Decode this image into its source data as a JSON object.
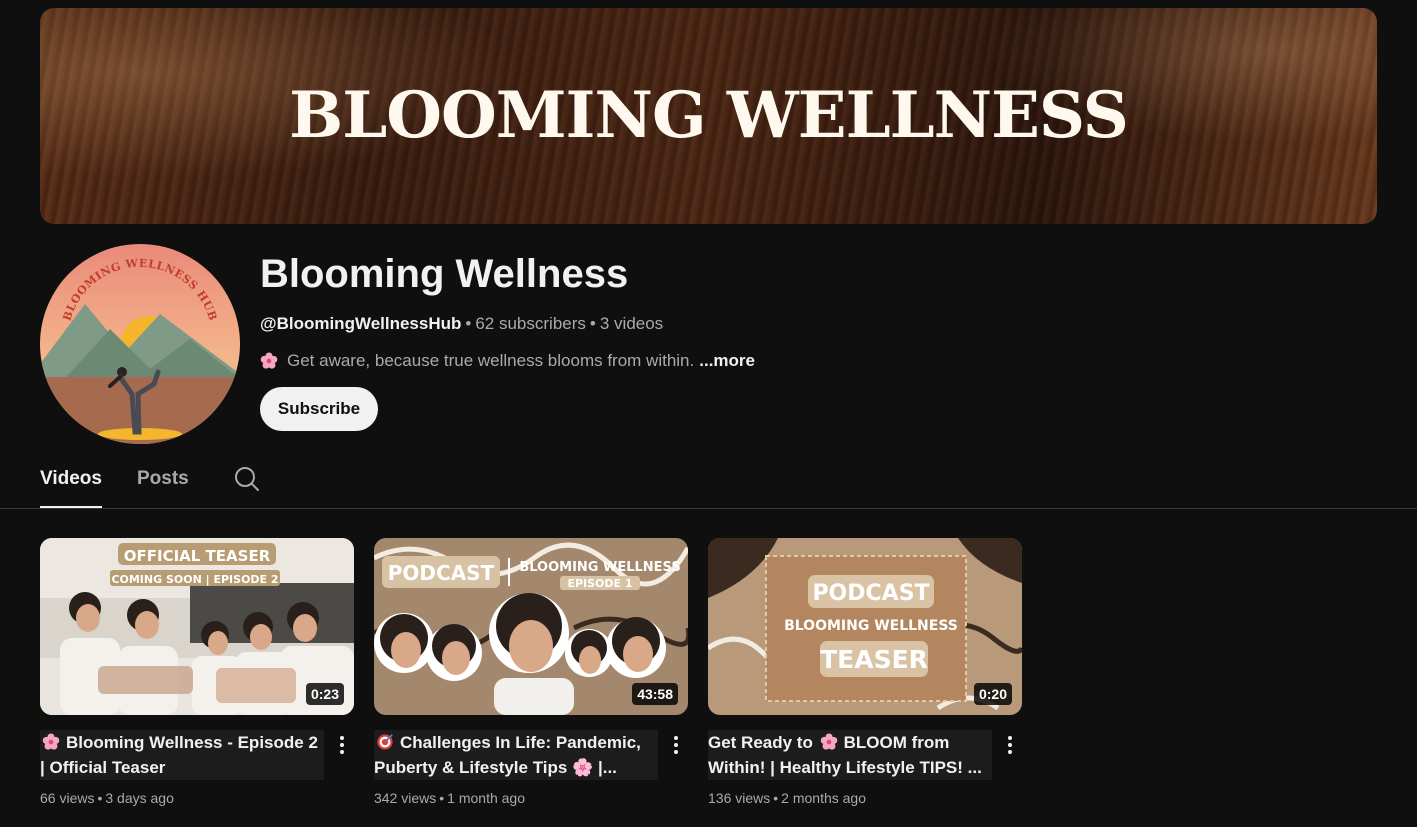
{
  "banner": {
    "title": "BLOOMING WELLNESS"
  },
  "channel": {
    "name": "Blooming Wellness",
    "handle": "@BloomingWellnessHub",
    "subscribers": "62 subscribers",
    "videos_count": "3 videos",
    "description": "Get aware, because true wellness blooms from within.",
    "more_label": "...more",
    "subscribe_label": "Subscribe",
    "avatar_text": "BLOOMING WELLNESS HUB"
  },
  "tabs": [
    {
      "label": "Videos",
      "active": true
    },
    {
      "label": "Posts",
      "active": false
    }
  ],
  "videos": [
    {
      "title": "Blooming Wellness - Episode 2 | Official Teaser",
      "title_icon": "flower-icon",
      "duration": "0:23",
      "views": "66 views",
      "age": "3 days ago",
      "thumb_text": [
        "OFFICIAL TEASER",
        "COMING SOON | EPISODE 2"
      ]
    },
    {
      "title": "Challenges In Life: Pandemic, Puberty & Lifestyle Tips 🌸 |...",
      "title_icon": "target-icon",
      "duration": "43:58",
      "views": "342 views",
      "age": "1 month ago",
      "thumb_text": [
        "PODCAST",
        "BLOOMING WELLNESS",
        "EPISODE 1"
      ]
    },
    {
      "title_pre": "Get Ready to",
      "title_post": "BLOOM from Within! | Healthy Lifestyle TIPS! ...",
      "title_icon": "flower-icon",
      "duration": "0:20",
      "views": "136 views",
      "age": "2 months ago",
      "thumb_text": [
        "PODCAST",
        "BLOOMING WELLNESS",
        "TEASER"
      ]
    }
  ],
  "colors": {
    "background": "#0f0f0f",
    "text": "#f1f1f1",
    "muted": "#aaaaaa",
    "subscribe_bg": "#f1f1f1"
  }
}
